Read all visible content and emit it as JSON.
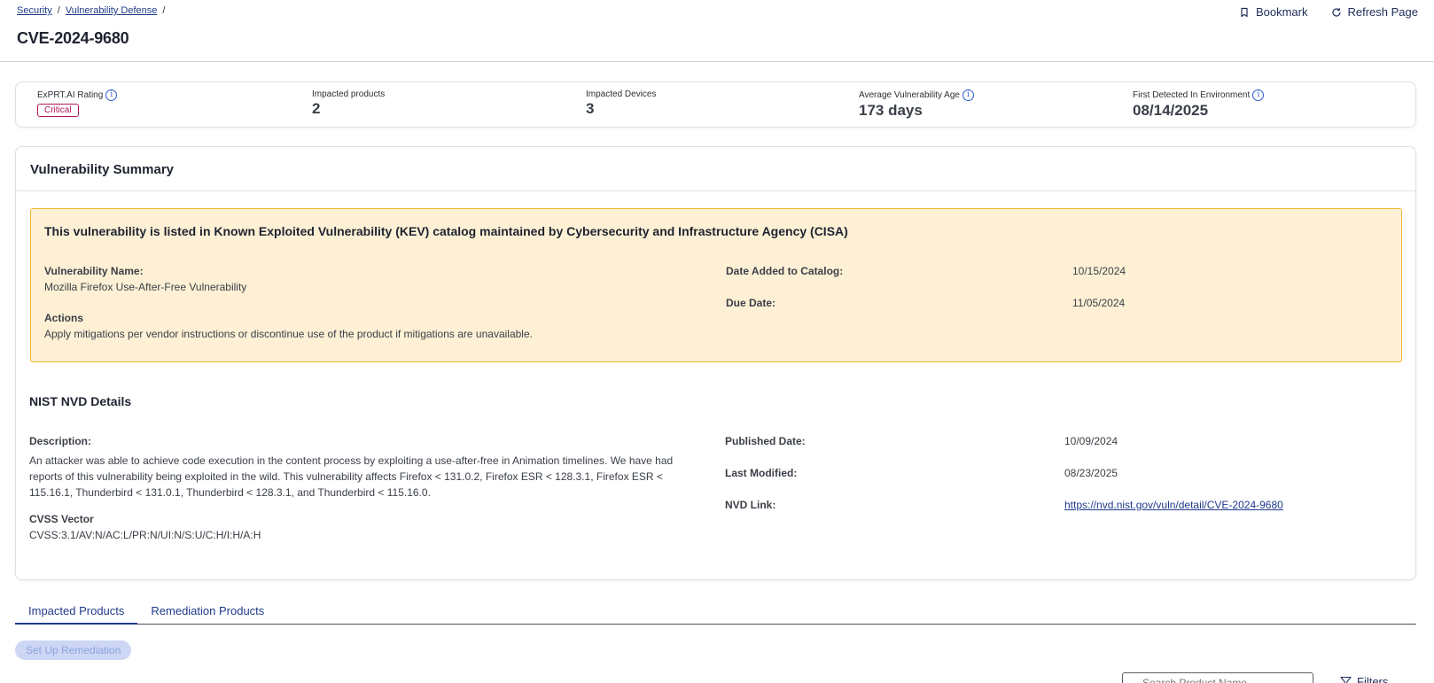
{
  "breadcrumb": {
    "items": [
      "Security",
      "Vulnerability Defense"
    ],
    "separator": "/"
  },
  "page": {
    "title": "CVE-2024-9680"
  },
  "header_actions": {
    "bookmark": "Bookmark",
    "refresh": "Refresh Page"
  },
  "stats": {
    "rating_label": "ExPRT.AI Rating",
    "rating_value": "Critical",
    "products_label": "Impacted products",
    "products_value": "2",
    "devices_label": "Impacted Devices",
    "devices_value": "3",
    "age_label": "Average Vulnerability Age",
    "age_value": "173 days",
    "first_detected_label": "First Detected In Environment",
    "first_detected_value": "08/14/2025"
  },
  "summary": {
    "title": "Vulnerability Summary",
    "kev": {
      "title": "This vulnerability is listed in Known Exploited Vulnerability (KEV) catalog maintained by Cybersecurity and Infrastructure Agency (CISA)",
      "name_label": "Vulnerability Name:",
      "name_value": "Mozilla Firefox Use-After-Free Vulnerability",
      "actions_label": "Actions",
      "actions_value": "Apply mitigations per vendor instructions or discontinue use of the product if mitigations are unavailable.",
      "date_added_label": "Date Added to Catalog:",
      "date_added_value": "10/15/2024",
      "due_date_label": "Due Date:",
      "due_date_value": "11/05/2024"
    },
    "nvd": {
      "title": "NIST NVD Details",
      "description_label": "Description:",
      "description_value": "An attacker was able to achieve code execution in the content process by exploiting a use-after-free in Animation timelines. We have had reports of this vulnerability being exploited in the wild. This vulnerability affects Firefox < 131.0.2, Firefox ESR < 128.3.1, Firefox ESR < 115.16.1, Thunderbird < 131.0.1, Thunderbird < 128.3.1, and Thunderbird < 115.16.0.",
      "cvss_label": "CVSS Vector",
      "cvss_value": "CVSS:3.1/AV:N/AC:L/PR:N/UI:N/S:U/C:H/I:H/A:H",
      "published_label": "Published Date:",
      "published_value": "10/09/2024",
      "modified_label": "Last Modified:",
      "modified_value": "08/23/2025",
      "link_label": "NVD Link:",
      "link_value": "https://nvd.nist.gov/vuln/detail/CVE-2024-9680"
    }
  },
  "tabs": [
    {
      "label": "Impacted Products",
      "active": true
    },
    {
      "label": "Remediation Products",
      "active": false
    }
  ],
  "remediation": {
    "setup_label": "Set Up Remediation"
  },
  "search": {
    "placeholder": "Search Product Name"
  },
  "filters": {
    "label": "Filters"
  },
  "colors": {
    "accent": "#1f3a8a",
    "critical": "#b0185a",
    "kev_bg": "#fdf0d5",
    "kev_border": "#f2b632"
  }
}
